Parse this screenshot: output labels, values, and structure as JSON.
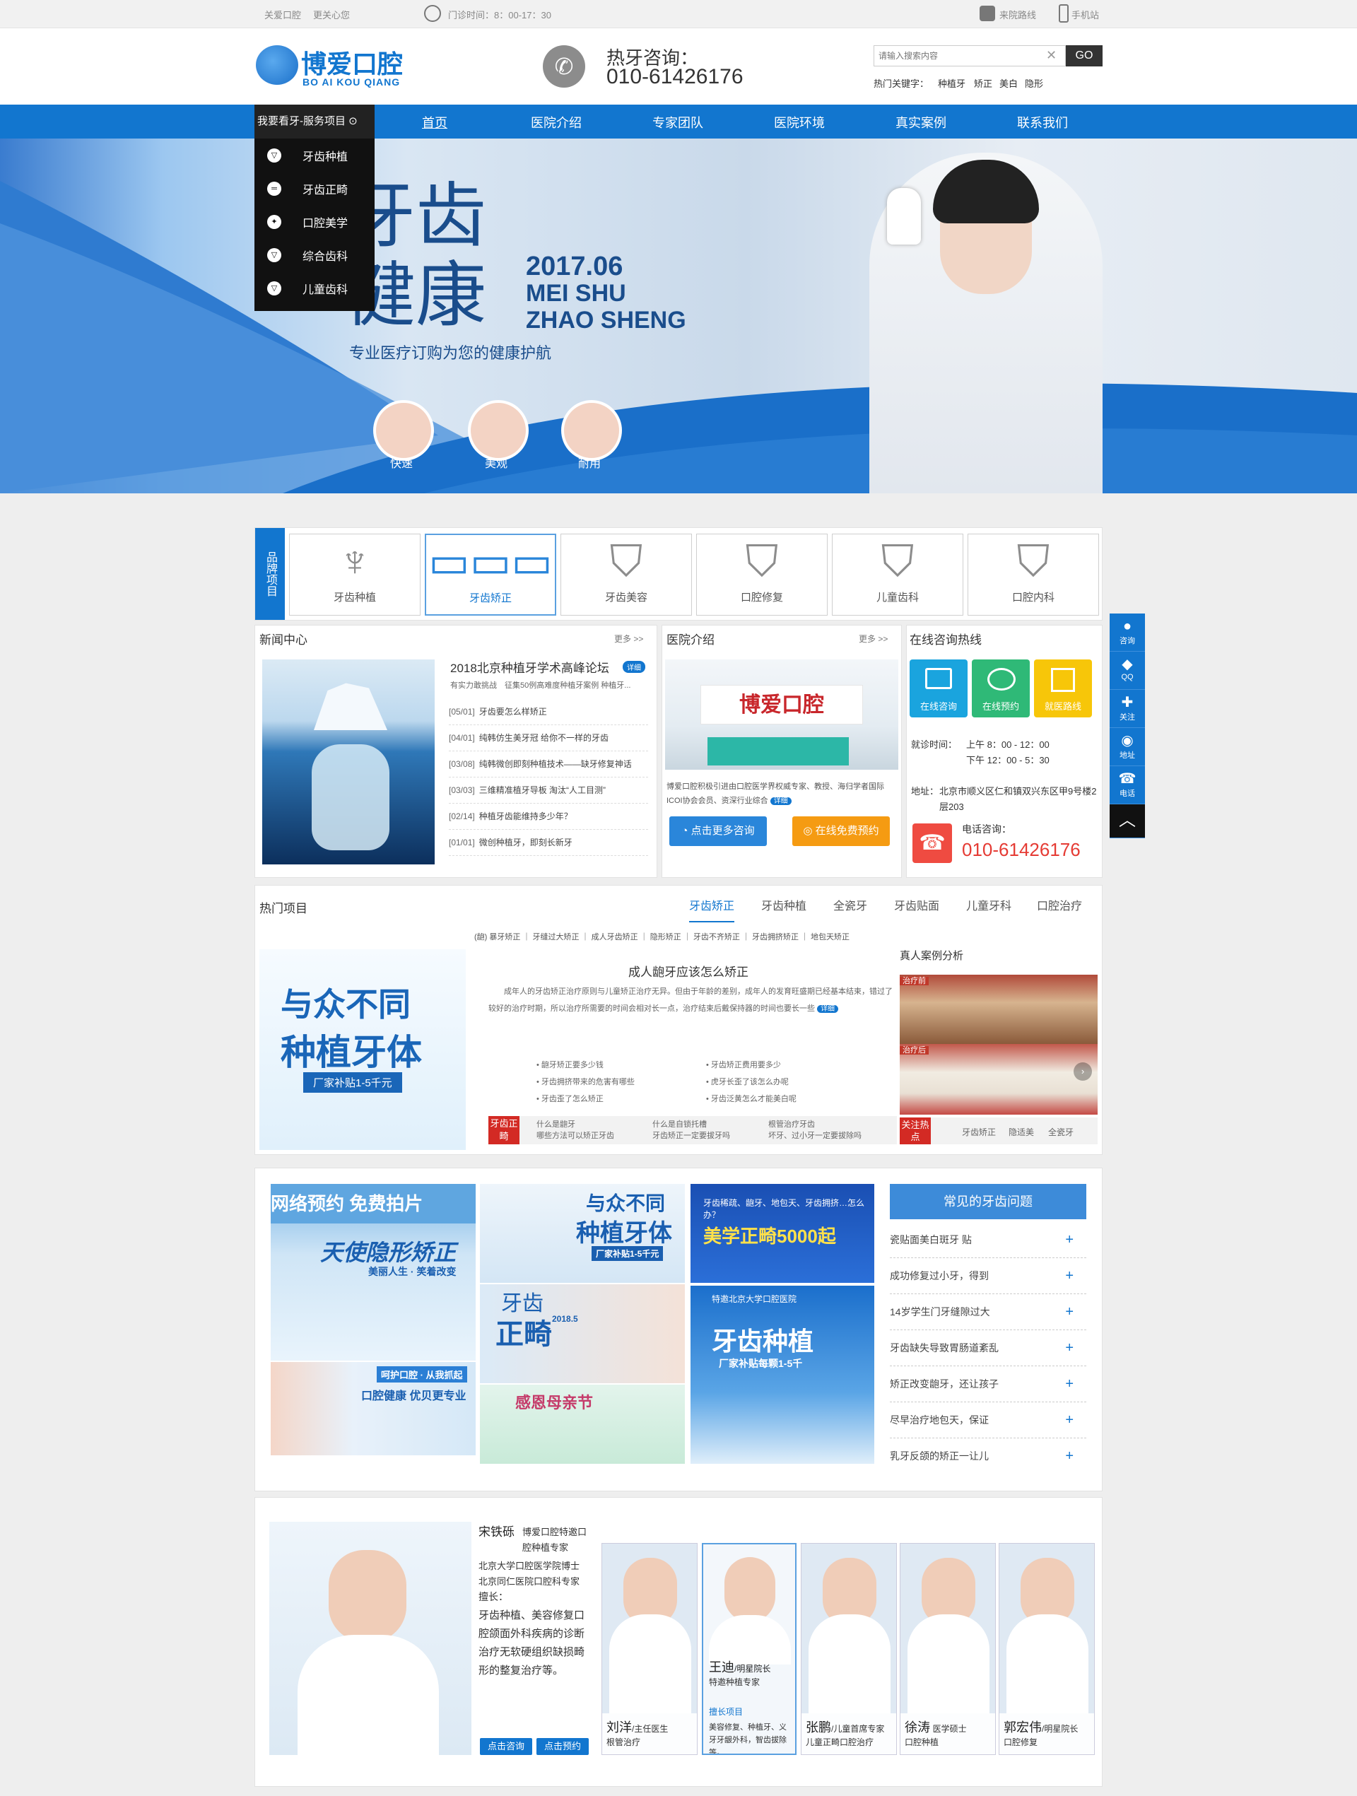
{
  "topbar": {
    "left1": "关爱口腔",
    "left2": "更关心您",
    "hours": "门诊时间：8：00-17：30",
    "route": "来院路线",
    "mobile": "手机站"
  },
  "header": {
    "logo_cn": "博爱口腔",
    "logo_en": "BO AI KOU QIANG",
    "hotline_label": "热牙咨询：",
    "hotline": "010-61426176",
    "search_placeholder": "请输入搜索内容",
    "search_btn": "GO",
    "hot_label": "热门关键字：",
    "hot_words": [
      "种植牙",
      "矫正",
      "美白",
      "隐形"
    ]
  },
  "nav": {
    "services_label": "我要看牙-服务项目",
    "items": [
      "首页",
      "医院介绍",
      "专家团队",
      "医院环境",
      "真实案例",
      "联系我们"
    ]
  },
  "services": [
    "牙齿种植",
    "牙齿正畸",
    "口腔美学",
    "综合齿科",
    "儿童齿科"
  ],
  "banner": {
    "title1": "牙齿",
    "title2": "健康",
    "date": "2017.06",
    "en1": "MEI SHU",
    "en2": "ZHAO SHENG",
    "slogan": "专业医疗订购为您的健康护航",
    "badges": [
      "快速",
      "美观",
      "耐用"
    ]
  },
  "brand": {
    "label": "品牌项目",
    "items": [
      "牙齿种植",
      "牙齿矫正",
      "牙齿美容",
      "口腔修复",
      "儿童齿科",
      "口腔内科"
    ]
  },
  "news": {
    "title": "新闻中心",
    "more": "更多 >>",
    "headline": "2018北京种植牙学术高峰论坛",
    "detail": "详细",
    "summary": "有实力敢挑战　征集50例高难度种植牙案例 种植牙...",
    "items": [
      {
        "date": "[05/01]",
        "text": "牙齿要怎么样矫正"
      },
      {
        "date": "[04/01]",
        "text": "纯韩仿生美牙冠 给你不一样的牙齿"
      },
      {
        "date": "[03/08]",
        "text": "纯韩微创即刻种植技术——缺牙修复神话"
      },
      {
        "date": "[03/03]",
        "text": "三维精准植牙导板 淘汰“人工目测”"
      },
      {
        "date": "[02/14]",
        "text": "种植牙齿能维持多少年？"
      },
      {
        "date": "[01/01]",
        "text": "微创种植牙，即刻长新牙"
      }
    ]
  },
  "intro": {
    "title": "医院介绍",
    "more": "更多 >>",
    "text": "博爱口腔积极引进由口腔医学界权威专家、教授、海归学者国际ICOI协会会员、资深行业综合",
    "detail": "详细",
    "btn1": "点击更多咨询",
    "btn2": "在线免费预约",
    "sign": "博爱口腔"
  },
  "consult": {
    "title": "在线咨询热线",
    "boxes": [
      "在线咨询",
      "在线预约",
      "就医路线"
    ],
    "hours_label": "就诊时间：",
    "am": "上午 8：00 - 12：00",
    "pm": "下午 12：00 - 5：30",
    "addr_label": "地址：",
    "addr": "北京市顺义区仁和镇双兴东区甲9号楼2层203",
    "phone_label": "电话咨询：",
    "phone": "010-61426176"
  },
  "hot": {
    "title": "热门项目",
    "tabs": [
      "牙齿矫正",
      "牙齿种植",
      "全瓷牙",
      "牙齿贴面",
      "儿童牙科",
      "口腔治疗"
    ],
    "sub": "(龅) 暴牙矫正 ｜ 牙缝过大矫正 ｜ 成人牙齿矫正 ｜ 隐形矫正 ｜ 牙齿不齐矫正 ｜ 牙齿拥挤矫正 ｜ 地包天矫正",
    "img_t1": "与众不同",
    "img_t2": "种植牙体",
    "img_t3": "厂家补贴1-5千元",
    "article_title": "成人龅牙应该怎么矫正",
    "article": "成年人的牙齿矫正治疗原则与儿童矫正治疗无异。但由于年龄的差别，成年人的发育旺盛期已经基本结束，错过了较好的治疗时期，所以治疗所需要的时间会相对长一点，治疗结束后戴保持器的时间也要长一些",
    "detail": "详细",
    "bullets": [
      "龅牙矫正要多少钱",
      "牙齿矫正费用要多少",
      "牙齿拥挤带来的危害有哪些",
      "虎牙长歪了该怎么办呢",
      "牙齿歪了怎么矫正",
      "牙齿泛黄怎么才能美白呢"
    ],
    "tag1": "牙齿正畸",
    "q": [
      {
        "a": "什么是龅牙",
        "b": "哪些方法可以矫正牙齿"
      },
      {
        "a": "什么是自锁托槽",
        "b": "牙齿矫正一定要拔牙吗"
      },
      {
        "a": "根管治疗牙齿",
        "b": "坏牙、过小牙一定要拔除吗"
      }
    ],
    "case_title": "真人案例分析",
    "before": "治疗前",
    "after": "治疗后",
    "tag2": "关注热点",
    "hot_words": [
      "牙齿矫正",
      "隐适美",
      "全瓷牙"
    ]
  },
  "promos": {
    "p1a": "网络预约 免费拍片",
    "p1b": "天使隐形矫正",
    "p1c": "美丽人生 · 笑着改变",
    "p1d": "呵护口腔 · 从我抓起",
    "p1e": "口腔健康 优贝更专业",
    "p2a": "与众不同",
    "p2b": "种植牙体",
    "p2c": "厂家补贴1-5千元",
    "p3a": "牙齿稀疏、龅牙、地包天、牙齿拥挤…怎么办？",
    "p3b": "美学正畸5000起",
    "p4a": "牙齿",
    "p4b": "正畸",
    "p4c": "2018.5",
    "p5a": "特邀北京大学口腔医院",
    "p5b": "牙齿种植",
    "p5c": "厂家补贴每颗1-5千",
    "p6a": "感恩母亲节"
  },
  "faq": {
    "title": "常见的牙齿问题",
    "items": [
      "瓷贴面美白斑牙 贴",
      "成功修复过小牙，得到",
      "14岁学生门牙缝隙过大",
      "牙齿缺失导致胃肠道紊乱",
      "矫正改变龅牙，还让孩子",
      "尽早治疗地包天，保证",
      "乳牙反颌的矫正一让儿"
    ]
  },
  "experts": {
    "main_name": "宋铁砾",
    "main_title": "博爱口腔特邀口腔种植专家",
    "main_desc1": "北京大学口腔医学院博士",
    "main_desc2": "北京同仁医院口腔科专家",
    "main_good_label": "擅长：",
    "main_good": "牙齿种植、美容修复口腔颌面外科疾病的诊断治疗无软硬组织缺损畸形的整复治疗等。",
    "btn1": "点击咨询",
    "btn2": "点击预约",
    "list": [
      {
        "name": "刘洋",
        "title": "/主任医生",
        "field": "根管治疗"
      },
      {
        "name": "王迪",
        "title": "/明星院长",
        "field": "特邀种植专家",
        "good_label": "擅长项目",
        "good": "美容修复、种植牙、义牙牙龈外科，智齿拔除等。"
      },
      {
        "name": "张鹏",
        "title": "/儿童首席专家",
        "field": "儿童正畸口腔治疗"
      },
      {
        "name": "徐涛",
        "title": "医学硕士",
        "field": "口腔种植"
      },
      {
        "name": "郭宏伟",
        "title": "/明星院长",
        "field": "口腔修复"
      }
    ]
  },
  "side": [
    "咨询",
    "QQ",
    "关注",
    "地址",
    "电话"
  ]
}
